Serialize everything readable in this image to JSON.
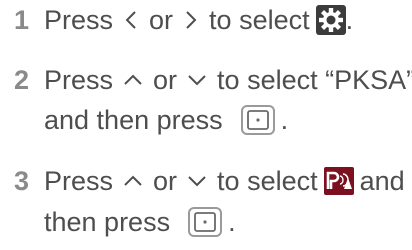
{
  "steps": [
    {
      "number": "1",
      "word_press": "Press",
      "word_or": "or",
      "word_to_select": "to select",
      "icons": [
        "chevron-left-icon",
        "chevron-right-icon",
        "settings-gear-icon"
      ],
      "end_punct": "."
    },
    {
      "number": "2",
      "word_press": "Press",
      "word_or": "or",
      "word_to_select": "to select “PKSA”",
      "line2_text": "and then press",
      "icons": [
        "chevron-up-icon",
        "chevron-down-icon",
        "enter-button-icon"
      ],
      "end_punct": "."
    },
    {
      "number": "3",
      "word_press": "Press",
      "word_or": "or",
      "word_to_select": "to select",
      "word_and": "and",
      "line2_text": "then press",
      "icons": [
        "chevron-up-icon",
        "chevron-down-icon",
        "pksa-icon",
        "enter-button-icon"
      ],
      "end_punct": "."
    }
  ],
  "colors": {
    "text": "#4e4e4e",
    "step_number": "#8a8a8a",
    "pksa_icon_bg": "#7a1020",
    "pksa_icon_fg": "#ffffff"
  }
}
